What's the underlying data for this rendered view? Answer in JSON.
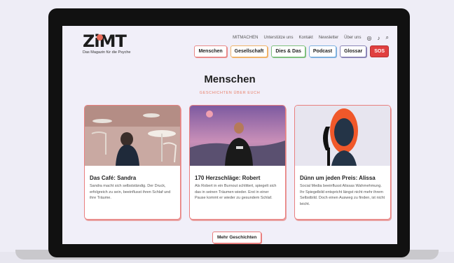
{
  "brand": {
    "name": "ZiMT",
    "tagline": "Das Magazin für die Psyche"
  },
  "topnav": [
    "MITMACHEN",
    "Unterstütze uns",
    "Kontakt",
    "Newsletter",
    "Über uns"
  ],
  "topnav_icons": [
    "instagram-icon",
    "tiktok-icon",
    "search-icon"
  ],
  "mainnav": [
    "Menschen",
    "Gesellschaft",
    "Dies & Das",
    "Podcast",
    "Glossar",
    "SOS"
  ],
  "page": {
    "title": "Menschen",
    "subtitle": "GESCHICHTEN ÜBER EUCH"
  },
  "cards": [
    {
      "title": "Das Café: Sandra",
      "text": "Sandra macht sich selbstständig. Der Druck, erfolgreich zu sein, beeinflusst ihren Schlaf und ihre Träume."
    },
    {
      "title": "170 Herzschläge: Robert",
      "text": "Als Robert in ein Burnout schlittert, spiegelt sich das in seinen Träumen wieder. Erst in einer Pause kommt er wieder zu gesundem Schlaf."
    },
    {
      "title": "Dünn um jeden Preis: Alissa",
      "text": "Social Media beeinflusst Alissas Wahrnehmung. Ihr Spiegelbild entspricht längst nicht mehr ihrem Selbstbild. Doch einen Ausweg zu finden, ist nicht leicht."
    }
  ],
  "more_button": "Mehr Geschichten",
  "colors": {
    "accent": "#e97f7f",
    "sos": "#e04040",
    "background": "#f1eff9"
  }
}
